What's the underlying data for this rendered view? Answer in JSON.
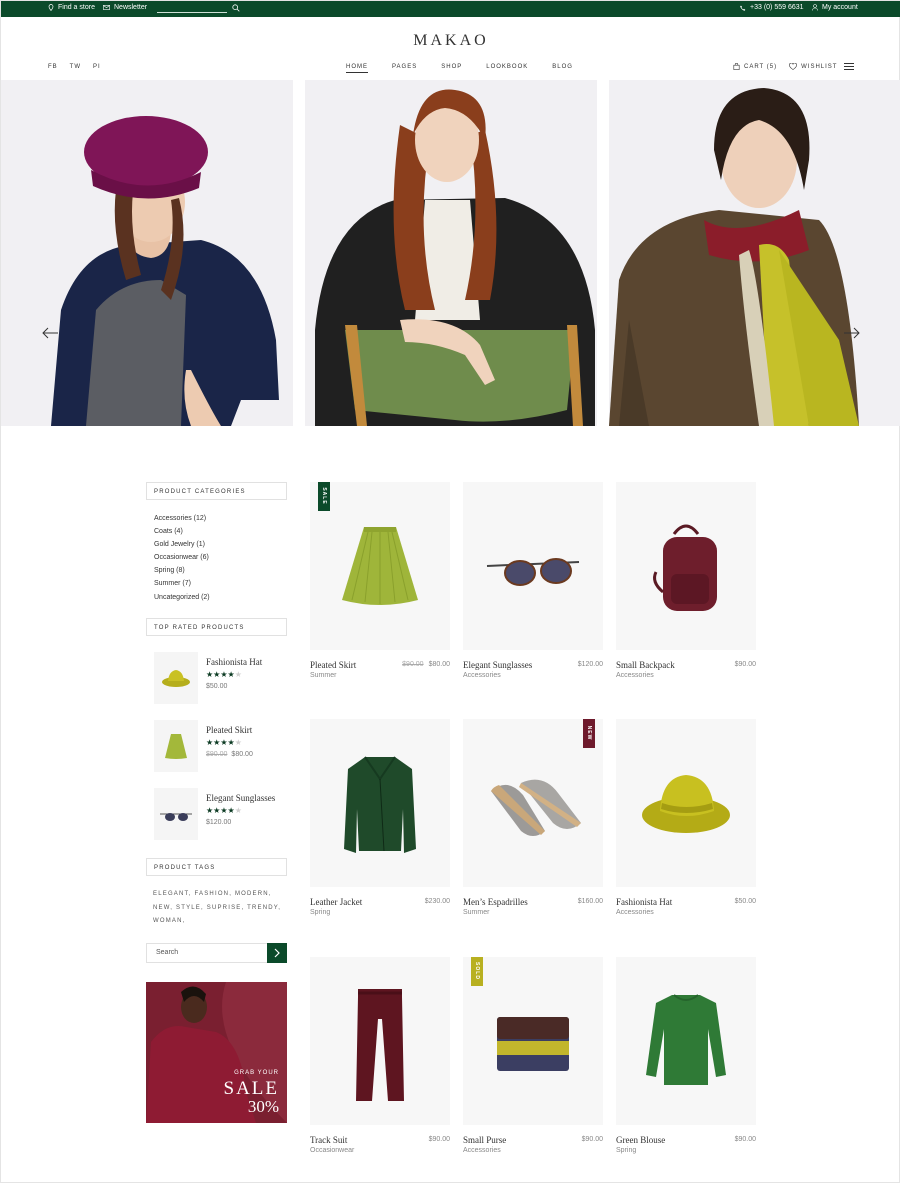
{
  "topbar": {
    "find_store": "Find a store",
    "newsletter": "Newsletter",
    "phone": "+33 (0) 559 6631",
    "account": "My account"
  },
  "logo": "MAKAO",
  "social": [
    "FB",
    "TW",
    "PI"
  ],
  "nav": [
    "HOME",
    "PAGES",
    "SHOP",
    "LOOKBOOK",
    "BLOG"
  ],
  "cart": "CART (5)",
  "wishlist": "WISHLIST",
  "sidebar": {
    "categories_title": "PRODUCT CATEGORIES",
    "categories": [
      "Accessories (12)",
      "Coats (4)",
      "Gold Jewelry (1)",
      "Occasionwear (6)",
      "Spring (8)",
      "Summer (7)",
      "Uncategorized (2)"
    ],
    "top_rated_title": "TOP RATED PRODUCTS",
    "top_rated": [
      {
        "name": "Fashionista Hat",
        "rating": 4,
        "price": "$50.00",
        "old_price": ""
      },
      {
        "name": "Pleated Skirt",
        "rating": 4,
        "price": "$80.00",
        "old_price": "$90.00"
      },
      {
        "name": "Elegant Sunglasses",
        "rating": 4,
        "price": "$120.00",
        "old_price": ""
      }
    ],
    "tags_title": "PRODUCT TAGS",
    "tags_lines": [
      "ELEGANT, FASHION, MODERN,",
      "NEW, STYLE, SUPRISE, TRENDY,",
      "WOMAN,"
    ],
    "search_placeholder": "Search",
    "promo": {
      "line1": "GRAB YOUR",
      "line2": "SALE",
      "line3": "30%"
    }
  },
  "products": [
    {
      "name": "Pleated Skirt",
      "category": "Summer",
      "price": "$80.00",
      "old_price": "$90.00",
      "badge": "SALE",
      "badge_color": "#0b4a2a"
    },
    {
      "name": "Elegant Sunglasses",
      "category": "Accessories",
      "price": "$120.00",
      "old_price": "",
      "badge": "",
      "badge_color": ""
    },
    {
      "name": "Small Backpack",
      "category": "Accessories",
      "price": "$90.00",
      "old_price": "",
      "badge": "",
      "badge_color": ""
    },
    {
      "name": "Leather Jacket",
      "category": "Spring",
      "price": "$230.00",
      "old_price": "",
      "badge": "",
      "badge_color": ""
    },
    {
      "name": "Men’s Espadrilles",
      "category": "Summer",
      "price": "$160.00",
      "old_price": "",
      "badge": "NEW",
      "badge_color": "#6e1a2c"
    },
    {
      "name": "Fashionista Hat",
      "category": "Accessories",
      "price": "$50.00",
      "old_price": "",
      "badge": "",
      "badge_color": ""
    },
    {
      "name": "Track Suit",
      "category": "Occasionwear",
      "price": "$90.00",
      "old_price": "",
      "badge": "",
      "badge_color": ""
    },
    {
      "name": "Small Purse",
      "category": "Accessories",
      "price": "$90.00",
      "old_price": "",
      "badge": "SOLD",
      "badge_color": "#b8b020"
    },
    {
      "name": "Green Blouse",
      "category": "Spring",
      "price": "$90.00",
      "old_price": "",
      "badge": "",
      "badge_color": ""
    }
  ],
  "colors": {
    "brand_green": "#0b4a2a",
    "accent_wine": "#7a1f30",
    "accent_olive": "#b8b020"
  }
}
